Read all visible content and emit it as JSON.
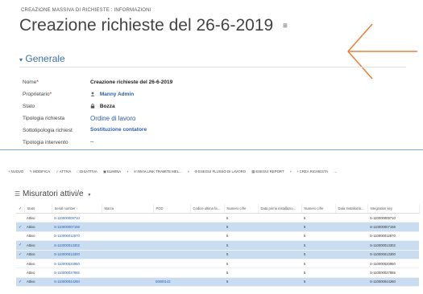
{
  "form": {
    "breadcrumb": "CREAZIONE MASSIVA DI RICHIESTE : INFORMAZIONI",
    "title": "Creazione richieste del 26-6-2019",
    "section_title": "Generale",
    "fields": {
      "nome_label": "Nome",
      "nome_value": "Creazione richieste del 26-6-2019",
      "proprietario_label": "Proprietario",
      "proprietario_value": "Manny Admin",
      "stato_label": "Stato",
      "stato_value": "Bozza",
      "tipologia_label": "Tipologia richiesta",
      "tipologia_value": "Ordine di lavoro",
      "sottotipologia_label": "Sottotipologia richiest",
      "sottotipologia_value": "Sostituzione contatore",
      "intervento_label": "Tipologia intervento",
      "intervento_value": "--"
    }
  },
  "toolbar": {
    "nuovo": "NUOVO",
    "modifica": "MODIFICA",
    "attiva": "ATTIVA",
    "disattiva": "DISATTIVA",
    "elimina": "ELIMINA",
    "invia_link": "INVIA LINK TRAMITE MEL...",
    "esegui_flusso": "ESEGUI FLUSSO DI LAVORO",
    "esegui_report": "ESEGUI REPORT",
    "crea_richiesta": "CREA RICHIESTA",
    "more": "..."
  },
  "subgrid": {
    "title": "Misuratori attivi/e",
    "columns": [
      "Stato",
      "Serial number ↑",
      "Marca",
      "POD",
      "Codice ultima fa...",
      "Numero cifre",
      "Data prima installazio...",
      "Numero cifre",
      "Data Installazio...",
      "Integration key"
    ],
    "rows": [
      {
        "selected": false,
        "stato": "Attivo",
        "serial": "S-110000009710",
        "pod": "",
        "cifre1": "5",
        "cifre2": "5",
        "key": "S-110000009710"
      },
      {
        "selected": true,
        "stato": "Attivo",
        "serial": "S-110000007158",
        "pod": "",
        "cifre1": "5",
        "cifre2": "5",
        "key": "S-110000007158"
      },
      {
        "selected": false,
        "stato": "Attivo",
        "serial": "S-110000012670",
        "pod": "",
        "cifre1": "5",
        "cifre2": "5",
        "key": "S-110000012670"
      },
      {
        "selected": true,
        "stato": "Attivo",
        "serial": "S-110000013302",
        "pod": "",
        "cifre1": "5",
        "cifre2": "5",
        "key": "S-110000013302"
      },
      {
        "selected": true,
        "stato": "Attivo",
        "serial": "S-110000013300",
        "pod": "",
        "cifre1": "5",
        "cifre2": "5",
        "key": "S-110000013300"
      },
      {
        "selected": false,
        "stato": "Attivo",
        "serial": "S-110000020950",
        "pod": "",
        "cifre1": "5",
        "cifre2": "5",
        "key": "S-110000020950"
      },
      {
        "selected": false,
        "stato": "Attivo",
        "serial": "S-110000037865",
        "pod": "",
        "cifre1": "5",
        "cifre2": "5",
        "key": "S-110000037865"
      },
      {
        "selected": true,
        "stato": "Attivo",
        "serial": "S-110000044260",
        "pod": "00000142",
        "cifre1": "5",
        "cifre2": "5",
        "key": "S-110000044260"
      }
    ]
  },
  "colors": {
    "accent": "#2a5db0",
    "arrow": "#e9823a",
    "selected_row": "#c9dcf0",
    "divider": "#7ab0d8"
  },
  "icons": {
    "title_menu": "list-menu-icon",
    "owner": "user-icon",
    "lock": "lock-icon",
    "pointer": "arrow-annotation-icon"
  }
}
